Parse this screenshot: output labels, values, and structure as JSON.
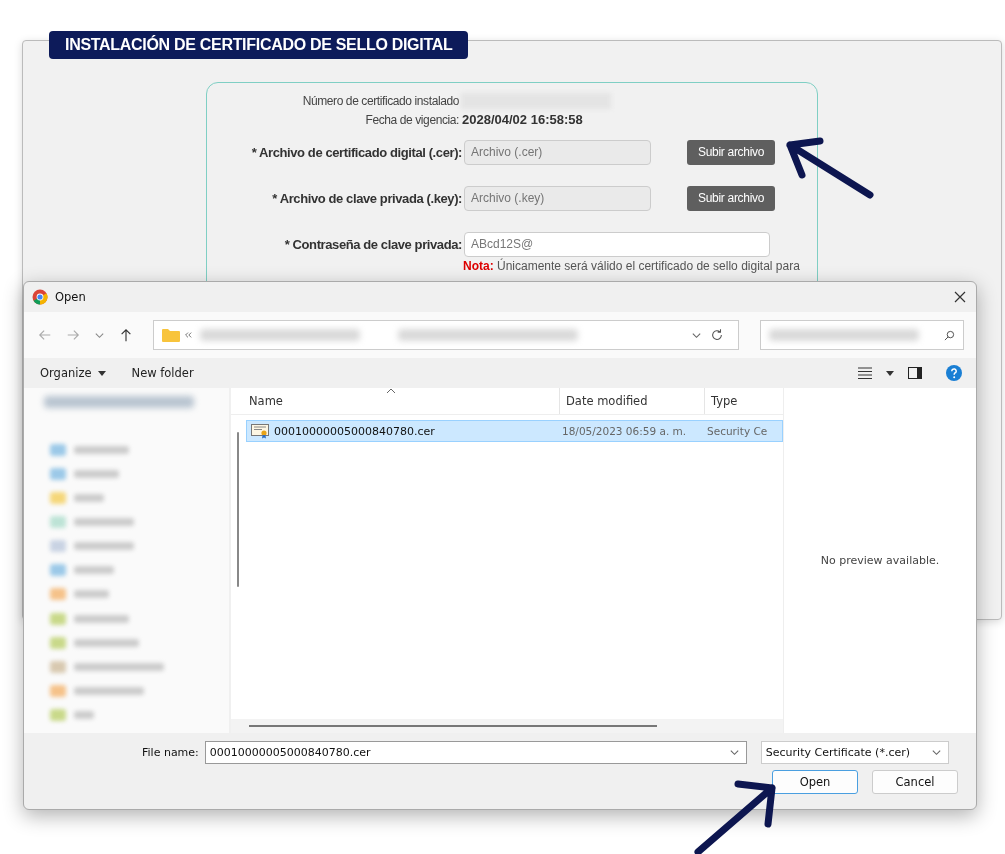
{
  "form": {
    "title": "INSTALACIÓN DE CERTIFICADO DE SELLO DIGITAL",
    "installed_label": "Número de certificado instalado",
    "expiry_label": "Fecha de vigencia:",
    "expiry_value": "2028/04/02 16:58:58",
    "inputs": [
      {
        "kind": "file",
        "label": "* Archivo de certificado digital (.cer):",
        "placeholder": "Archivo (.cer)",
        "button": "Subir archivo"
      },
      {
        "kind": "file",
        "label": "* Archivo de clave privada (.key):",
        "placeholder": "Archivo (.key)",
        "button": "Subir archivo"
      },
      {
        "kind": "password",
        "label": "* Contraseña de clave privada:",
        "value": "ABcd12S@"
      }
    ],
    "note": {
      "label": "Nota:",
      "text": "Únicamente será válido el certificado de sello digital para"
    }
  },
  "dialog": {
    "title": "Open",
    "organize": "Organize",
    "new_folder": "New folder",
    "columns": [
      "Name",
      "Date modified",
      "Type"
    ],
    "files": [
      {
        "name": "00010000005000840780.cer",
        "date": "18/05/2023 06:59 a. m.",
        "type": "Security Ce",
        "selected": true
      }
    ],
    "preview": "No preview available.",
    "file_name_label": "File name:",
    "file_name": "00010000005000840780.cer",
    "filter": "Security Certificate (*.cer)",
    "buttons": [
      {
        "label": "Open",
        "default": true
      },
      {
        "label": "Cancel",
        "default": false
      }
    ]
  }
}
